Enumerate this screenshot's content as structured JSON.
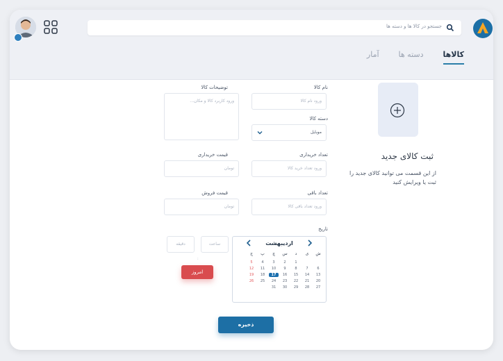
{
  "header": {
    "search_placeholder": "جستجو در کالا ها و دسته ها",
    "tabs": [
      {
        "label": "کالاها",
        "active": true
      },
      {
        "label": "دسته ها",
        "active": false
      },
      {
        "label": "آمار",
        "active": false
      }
    ],
    "icons": {
      "logo": "app-logo",
      "search": "search-icon",
      "apps": "grid-icon",
      "avatar": "user-avatar"
    }
  },
  "new_item": {
    "title": "ثبت کالای جدید",
    "description": "از این قسمت می توانید کالای جدید را ثبت یا ویرایش کنید"
  },
  "form": {
    "name": {
      "label": "نام کالا",
      "placeholder": "ورود نام کالا"
    },
    "description": {
      "label": "توضیحات کالا",
      "placeholder": "ورود کاربرد کالا و مکان..."
    },
    "category": {
      "label": "دسته کالا",
      "value": "موبایل"
    },
    "purchase_count": {
      "label": "تعداد خریداری",
      "placeholder": "ورود تعداد خرید کالا"
    },
    "purchase_price": {
      "label": "قیمت خریداری",
      "placeholder": "تومان"
    },
    "remaining_count": {
      "label": "تعداد باقی",
      "placeholder": "ورود تعداد باقی کالا"
    },
    "sale_price": {
      "label": "قیمت فروش",
      "placeholder": "تومان"
    },
    "date": {
      "label": "تاریخ"
    },
    "hour_placeholder": "ساعت",
    "minute_placeholder": "دقیقه",
    "time_separator": ":",
    "today_label": "امروز",
    "save_label": "ذخیره"
  },
  "calendar": {
    "month": "اردیبهشت",
    "weekdays": [
      "ش",
      "ی",
      "د",
      "س",
      "چ",
      "پ",
      "ج"
    ],
    "rows": [
      [
        "",
        "",
        "1",
        "2",
        "3",
        "4",
        "5",
        "6"
      ],
      [
        "7",
        "8",
        "9",
        "10",
        "11",
        "12",
        "13"
      ],
      [
        "14",
        "15",
        "16",
        "17",
        "18",
        "19",
        "20"
      ],
      [
        "21",
        "22",
        "23",
        "24",
        "25",
        "26",
        "27"
      ],
      [
        "28",
        "29",
        "30",
        "31",
        "",
        "",
        ""
      ]
    ],
    "selected_day": "17",
    "colors": {
      "accent": "#1b6fae",
      "holiday": "#e2585b"
    }
  },
  "colors": {
    "primary": "#1d6fa5",
    "danger": "#d94c4f",
    "tab_underline": "#2a7ea8"
  }
}
